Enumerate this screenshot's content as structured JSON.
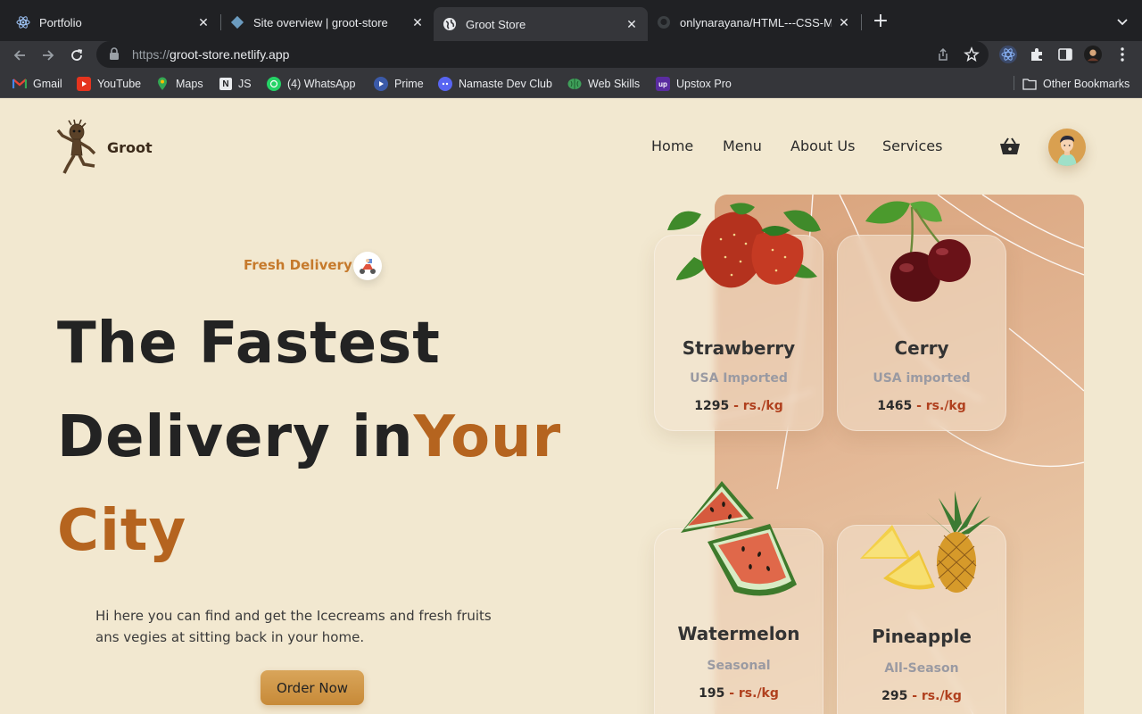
{
  "browser": {
    "tabs": [
      {
        "title": "Portfolio",
        "icon": "react-icon",
        "active": false
      },
      {
        "title": "Site overview | groot-store",
        "icon": "netlify-icon",
        "active": false
      },
      {
        "title": "Groot Store",
        "icon": "globe-icon",
        "active": true
      },
      {
        "title": "onlynarayana/HTML---CSS-Mi",
        "icon": "github-icon",
        "active": false
      }
    ],
    "url_scheme": "https://",
    "url_host": "groot-store.netlify.app",
    "bookmarks": [
      {
        "label": "Gmail",
        "icon": "gmail-icon"
      },
      {
        "label": "YouTube",
        "icon": "youtube-icon"
      },
      {
        "label": "Maps",
        "icon": "maps-icon"
      },
      {
        "label": "JS",
        "icon": "notion-icon"
      },
      {
        "label": "(4) WhatsApp",
        "icon": "whatsapp-icon"
      },
      {
        "label": "Prime",
        "icon": "prime-icon"
      },
      {
        "label": "Namaste Dev Club",
        "icon": "discord-icon"
      },
      {
        "label": "Web Skills",
        "icon": "brain-icon"
      },
      {
        "label": "Upstox Pro",
        "icon": "upstox-icon"
      }
    ],
    "other_bookmarks": "Other Bookmarks"
  },
  "site": {
    "brand": "Groot",
    "nav": [
      "Home",
      "Menu",
      "About Us",
      "Services"
    ],
    "tag": "Fresh Delivery",
    "hero": {
      "line1": "The Fastest",
      "line2a": "Delivery in",
      "line2b": "Your",
      "line3": "City"
    },
    "description_line1": "Hi here you can find and get the Icecreams and fresh fruits",
    "description_line2": "ans vegies at sitting back in your home.",
    "cta": "Order Now",
    "accent_color": "#b5641f",
    "products": [
      {
        "name": "Strawberry",
        "origin": "USA Imported",
        "price": "1295",
        "unit": " - rs./kg"
      },
      {
        "name": "Cerry",
        "origin": "USA imported",
        "price": "1465",
        "unit": " - rs./kg"
      },
      {
        "name": "Watermelon",
        "origin": "Seasonal",
        "price": "195",
        "unit": " - rs./kg"
      },
      {
        "name": "Pineapple",
        "origin": "All-Season",
        "price": "295",
        "unit": " - rs./kg"
      }
    ]
  }
}
